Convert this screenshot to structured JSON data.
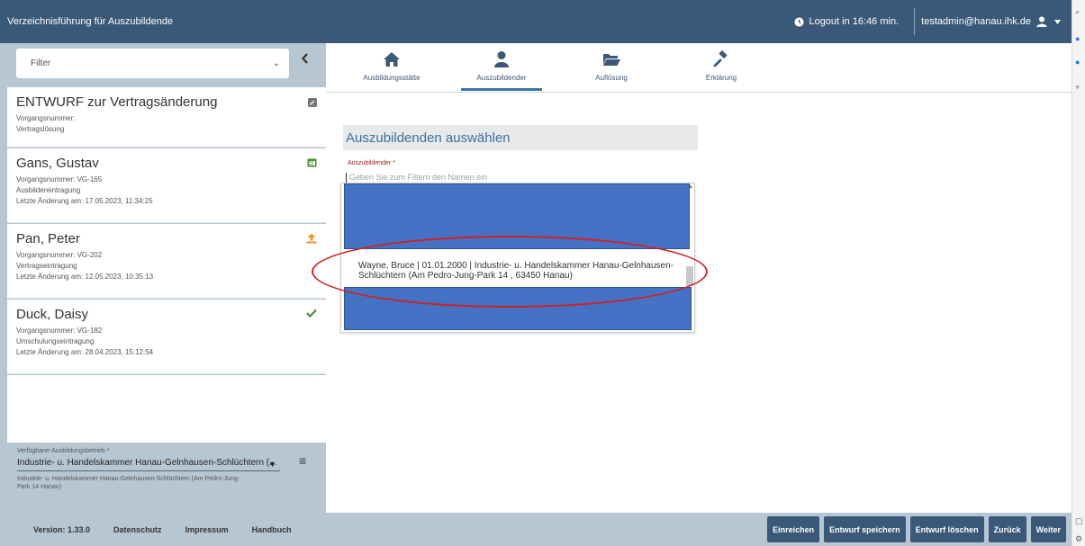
{
  "header": {
    "title": "Verzeichnisführung für Auszubildende",
    "logout": "Logout in 16:46 min.",
    "user": "testadmin@hanau.ihk.de"
  },
  "sidebar": {
    "filter": {
      "label": "Filter"
    },
    "cards": [
      {
        "title": "ENTWURF zur Vertragsänderung",
        "lines": [
          "Vorgangsnummer:",
          "Vertragslösung"
        ],
        "icon": "edit-icon"
      },
      {
        "title": "Gans, Gustav",
        "lines": [
          "Vorgangsnummer: VG-165",
          "Ausbildereintragung",
          "Letzte Änderung am: 17.05.2023, 11:34:25"
        ],
        "icon": "calendar-icon"
      },
      {
        "title": "Pan, Peter",
        "lines": [
          "Vorgangsnummer: VG-202",
          "Vertragseintragung",
          "Letzte Änderung am: 12.05.2023, 10:35:13"
        ],
        "icon": "upload-icon"
      },
      {
        "title": "Duck, Daisy",
        "lines": [
          "Vorgangsnummer: VG-182",
          "Umschulungseintragung",
          "Letzte Änderung am: 28.04.2023, 15:12:54"
        ],
        "icon": "check-icon"
      }
    ],
    "company": {
      "label": "Verfügbarer Ausbildungsbetrieb *",
      "selected": "Industrie- u. Handelskammer Hanau-Gelnhausen-Schlüchtern (...",
      "address": "Industrie- u. Handelskammer Hanau-Gelnhausen-Schlüchtern (Am Pedro-Jung-Park 14 Hanau)"
    }
  },
  "tabs": [
    {
      "label": "Ausbildungsstätte",
      "icon": "home-icon"
    },
    {
      "label": "Auszubildender",
      "icon": "user-icon",
      "active": true
    },
    {
      "label": "Auflösung",
      "icon": "folder-open-icon"
    },
    {
      "label": "Erklärung",
      "icon": "gavel-icon"
    }
  ],
  "main": {
    "heading": "Auszubildenden auswählen",
    "field_label": "Auszubildender *",
    "placeholder": "Geben Sie zum Filtern den Namen ein",
    "option": "Wayne, Bruce | 01.01.2000 | Industrie- u. Handelskammer Hanau-Gelnhausen-Schlüchtern (Am Pedro-Jung-Park 14 , 63450 Hanau)"
  },
  "footer": {
    "version": "Version: 1.33.0",
    "links": [
      "Datenschutz",
      "Impressum",
      "Handbuch"
    ],
    "buttons": [
      "Einreichen",
      "Entwurf speichern",
      "Entwurf löschen",
      "Zurück",
      "Weiter"
    ]
  },
  "colors": {
    "header": "#3a5877",
    "sidebar": "#b7c6d3",
    "redaction": "#4472c4",
    "highlight": "#d42020"
  }
}
